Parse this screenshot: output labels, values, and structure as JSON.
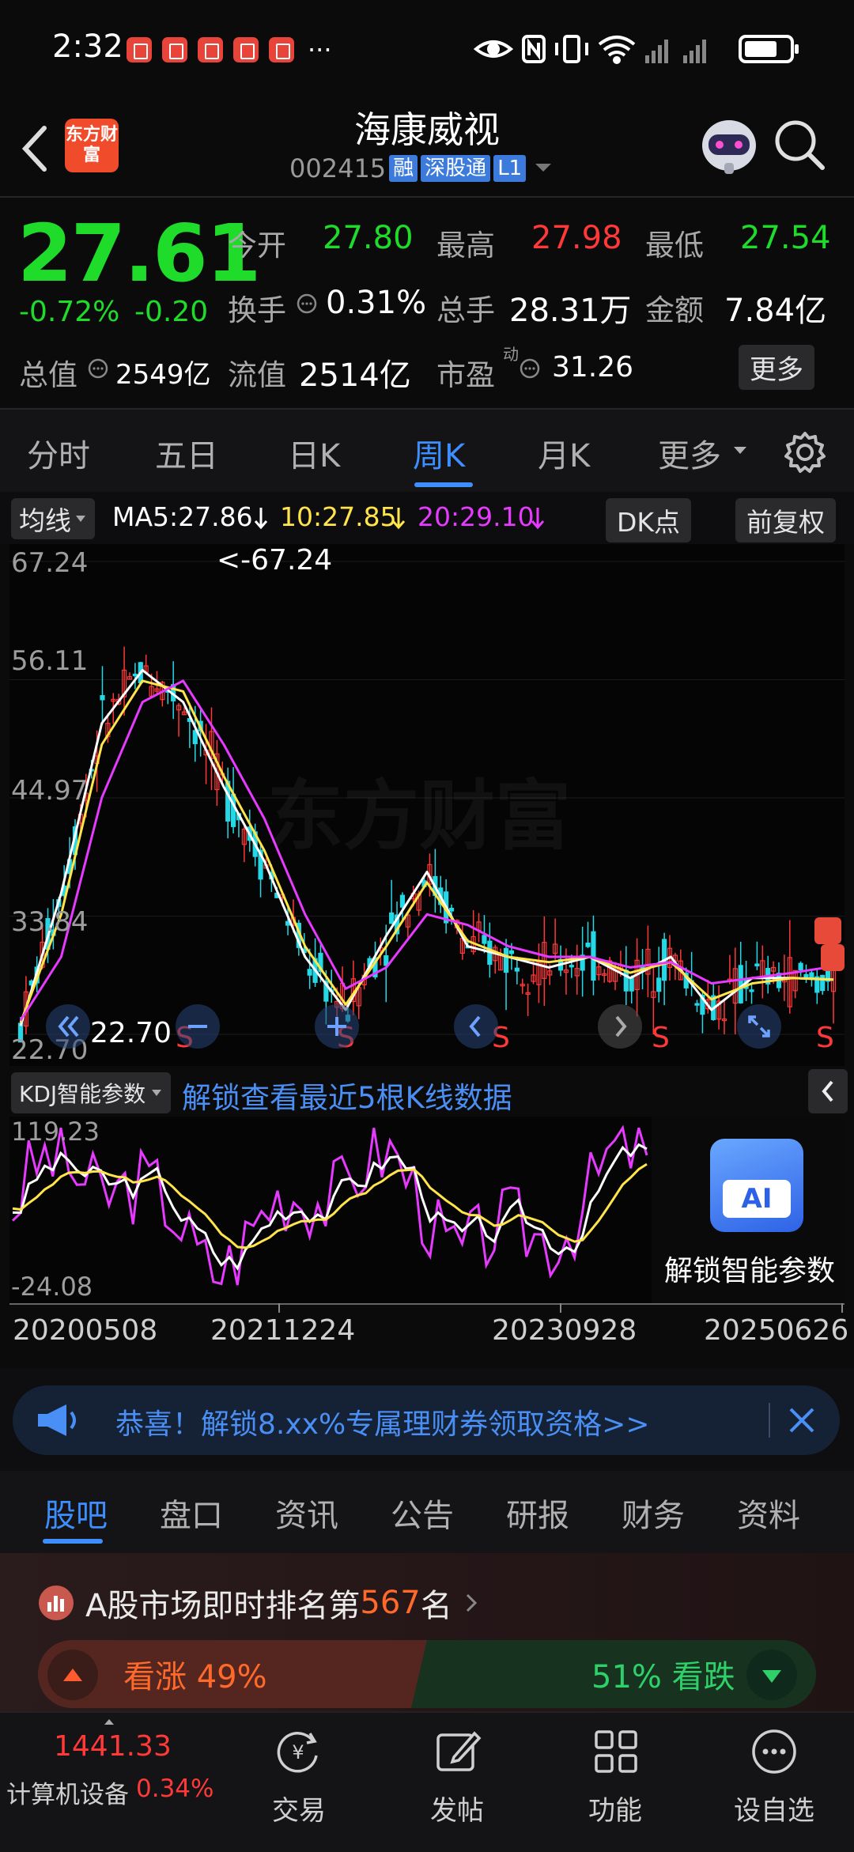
{
  "status_bar": {
    "time": "2:32",
    "ellipsis": "···"
  },
  "header": {
    "title": "海康威视",
    "code": "002415",
    "tags": [
      "融",
      "深股通",
      "L1"
    ],
    "logo_text": "东方财富",
    "back_icon": "chevron-left-icon",
    "search_icon": "search-icon"
  },
  "quote": {
    "price": "27.61",
    "change_pct": "-0.72%",
    "change_abs": "-0.20",
    "open_label": "今开",
    "open": "27.80",
    "high_label": "最高",
    "high": "27.98",
    "low_label": "最低",
    "low": "27.54",
    "turnover_label": "换手",
    "turnover": "0.31%",
    "volume_label": "总手",
    "volume": "28.31万",
    "amount_label": "金额",
    "amount": "7.84亿",
    "mktcap_label": "总值",
    "mktcap": "2549亿",
    "float_label": "流值",
    "float": "2514亿",
    "pe_label": "市盈",
    "pe_sup": "动",
    "pe": "31.26",
    "more_button": "更多"
  },
  "period_tabs": [
    "分时",
    "五日",
    "日K",
    "周K",
    "月K",
    "更多"
  ],
  "active_period": 3,
  "ma_bar": {
    "selector": "均线",
    "ma5": "MA5:27.86",
    "ma10": "10:27.85",
    "ma20": "20:29.10",
    "dk_button": "DK点",
    "adjust_button": "前复权"
  },
  "kline": {
    "y_labels": [
      "67.24",
      "56.11",
      "44.97",
      "33.84",
      "22.70"
    ],
    "max_marker": "<-67.24",
    "min_marker": "22.70",
    "watermark": "东方财富",
    "signal_label": "S"
  },
  "kdj": {
    "selector": "KDJ智能参数",
    "unlock_text": "解锁查看最近5根K线数据",
    "y_top": "119.23",
    "y_bottom": "-24.08",
    "ai_badge": "AI",
    "ai_unlock": "解锁智能参数"
  },
  "x_dates": [
    "20200508",
    "20211224",
    "20230928",
    "20250626"
  ],
  "chart_data": {
    "type": "line",
    "title": "",
    "xlabel": "",
    "ylabel": "",
    "x": [
      "20200508",
      "20211224",
      "20230928",
      "20250626"
    ],
    "ylim": [
      22.7,
      67.24
    ],
    "series": [
      {
        "name": "MA5",
        "values": [
          23.5,
          36,
          52,
          57,
          54,
          46,
          39,
          30,
          25,
          32,
          38,
          31,
          30,
          29,
          30,
          28,
          30,
          25,
          28,
          28,
          27.86
        ]
      },
      {
        "name": "10",
        "values": [
          23.8,
          34,
          50,
          56,
          55,
          47,
          40,
          31,
          25.5,
          31,
          37,
          31.5,
          30,
          29.5,
          30,
          28.5,
          29.5,
          26,
          27.5,
          28,
          27.85
        ]
      },
      {
        "name": "20",
        "values": [
          24,
          30,
          45,
          54,
          56,
          50,
          43,
          34,
          27,
          29,
          34,
          33,
          31,
          30,
          30,
          29,
          29.5,
          27.5,
          28,
          28.5,
          29.1
        ]
      }
    ],
    "kdj_ylim": [
      -24.08,
      119.23
    ]
  },
  "banner": {
    "text": "恭喜！解锁8.xx%专属理财券领取资格>>"
  },
  "section_tabs": [
    "股吧",
    "盘口",
    "资讯",
    "公告",
    "研报",
    "财务",
    "资料"
  ],
  "active_section": 0,
  "ranking": {
    "prefix": "A股市场即时排名第",
    "rank": "567",
    "suffix": "名"
  },
  "sentiment": {
    "up_label": "看涨 49%",
    "down_label": "51% 看跌",
    "up": 49,
    "down": 51
  },
  "bottom_nav": {
    "index_value": "1441.33",
    "index_name": "计算机设备",
    "index_pct": "0.34%",
    "items": [
      "交易",
      "发帖",
      "功能",
      "设自选"
    ]
  },
  "colors": {
    "up": "#ff3838",
    "down": "#1fdc2b",
    "accent": "#3d8fff",
    "ma5": "#ffffff",
    "ma10": "#ffe44a",
    "ma20": "#e63aff"
  }
}
